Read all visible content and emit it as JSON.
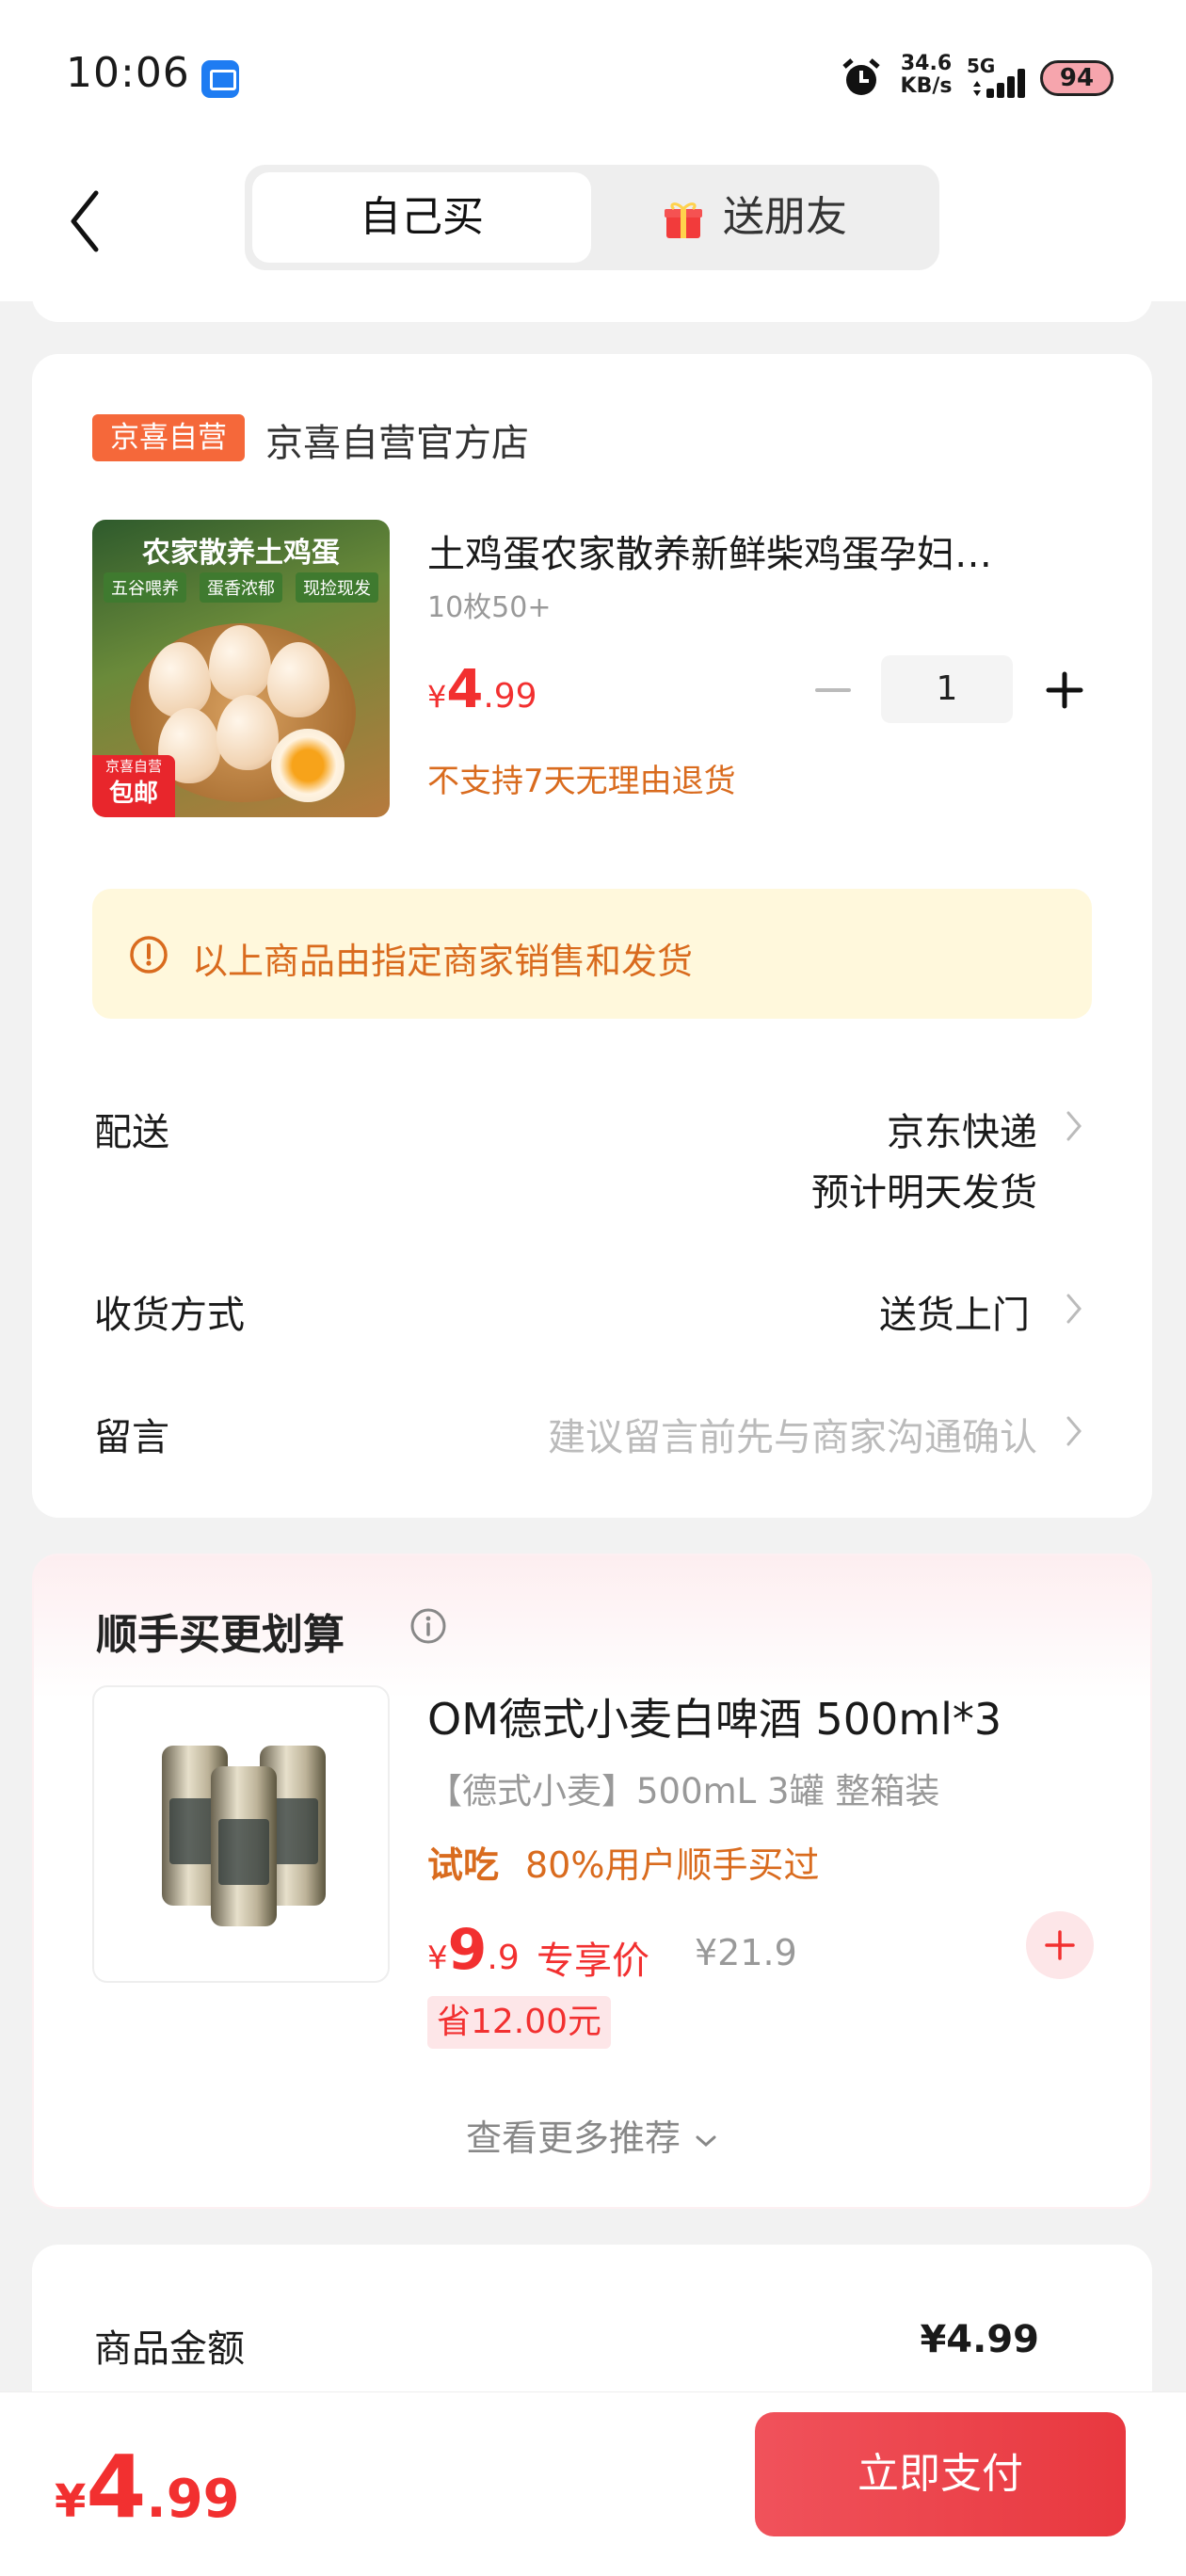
{
  "status_bar": {
    "time": "10:06",
    "net_speed_value": "34.6",
    "net_speed_unit": "KB/s",
    "network_type": "5G",
    "battery": "94"
  },
  "header": {
    "tab_self": "自己买",
    "tab_gift": "送朋友"
  },
  "order": {
    "store_tag": "京喜自营",
    "store_name": "京喜自营官方店",
    "product": {
      "image_title": "农家散养土鸡蛋",
      "image_tags": [
        "五谷喂养",
        "蛋香浓郁",
        "现捡现发"
      ],
      "image_badge_top": "京喜自营",
      "image_badge_bottom": "包邮",
      "title": "土鸡蛋农家散养新鲜柴鸡蛋孕妇…",
      "spec": "10枚50+",
      "price_symbol": "¥",
      "price_int": "4",
      "price_dec": ".99",
      "quantity": "1",
      "return_policy": "不支持7天无理由退货"
    },
    "notice": "以上商品由指定商家销售和发货",
    "delivery_label": "配送",
    "delivery_value": "京东快递",
    "delivery_sub": "预计明天发货",
    "receive_label": "收货方式",
    "receive_value": "送货上门",
    "message_label": "留言",
    "message_placeholder": "建议留言前先与商家沟通确认"
  },
  "recommend": {
    "title": "顺手买更划算",
    "item": {
      "title": "OM德式小麦白啤酒  500ml*3",
      "spec": "【德式小麦】500mL 3罐 整箱装",
      "try_tag": "试吃",
      "try_text": "80%用户顺手买过",
      "price_symbol": "¥",
      "price_int": "9",
      "price_dec": ".9",
      "exclusive_label": "专享价",
      "original_price": "¥21.9",
      "save_text": "省12.00元"
    },
    "more": "查看更多推荐"
  },
  "summary": {
    "goods_amount_label": "商品金额",
    "goods_amount_value": "¥4.99"
  },
  "bottom": {
    "price_symbol": "¥",
    "price_int": "4",
    "price_dec": ".99",
    "pay_label": "立即支付"
  },
  "colors": {
    "accent_red": "#f23030",
    "warn_orange": "#d96b1e",
    "store_tag": "#f5683a",
    "notice_bg": "#fff8dc"
  }
}
